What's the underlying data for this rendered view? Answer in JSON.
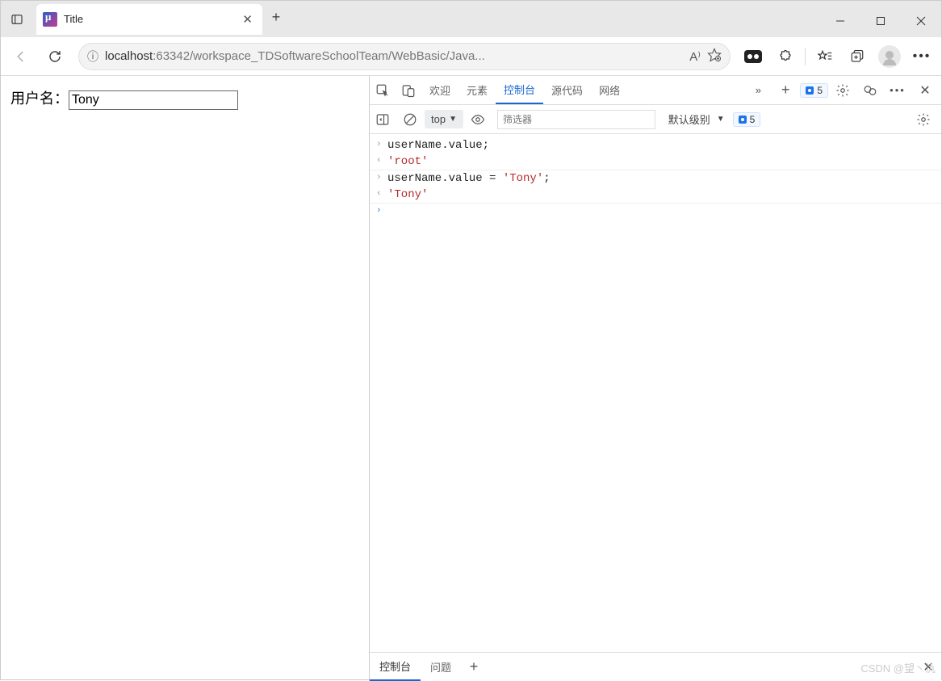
{
  "window": {
    "tab_title": "Title"
  },
  "toolbar": {
    "url_host": "localhost",
    "url_rest": ":63342/workspace_TDSoftwareSchoolTeam/WebBasic/Java..."
  },
  "page": {
    "label": "用户名：",
    "input_value": "Tony"
  },
  "devtools": {
    "tabs": {
      "welcome": "欢迎",
      "elements": "元素",
      "console": "控制台",
      "sources": "源代码",
      "network": "网络"
    },
    "issue_count": "5",
    "filterbar": {
      "context": "top",
      "filter_placeholder": "筛选器",
      "level": "默认级别",
      "issue_count2": "5"
    },
    "console": {
      "line1": "userName.value;",
      "result1": "'root'",
      "line2_pre": "userName.value = ",
      "line2_str": "'Tony'",
      "line2_post": ";",
      "result2": "'Tony'"
    },
    "drawer": {
      "console": "控制台",
      "issues": "问题"
    }
  },
  "watermark": "CSDN @望丶氿"
}
